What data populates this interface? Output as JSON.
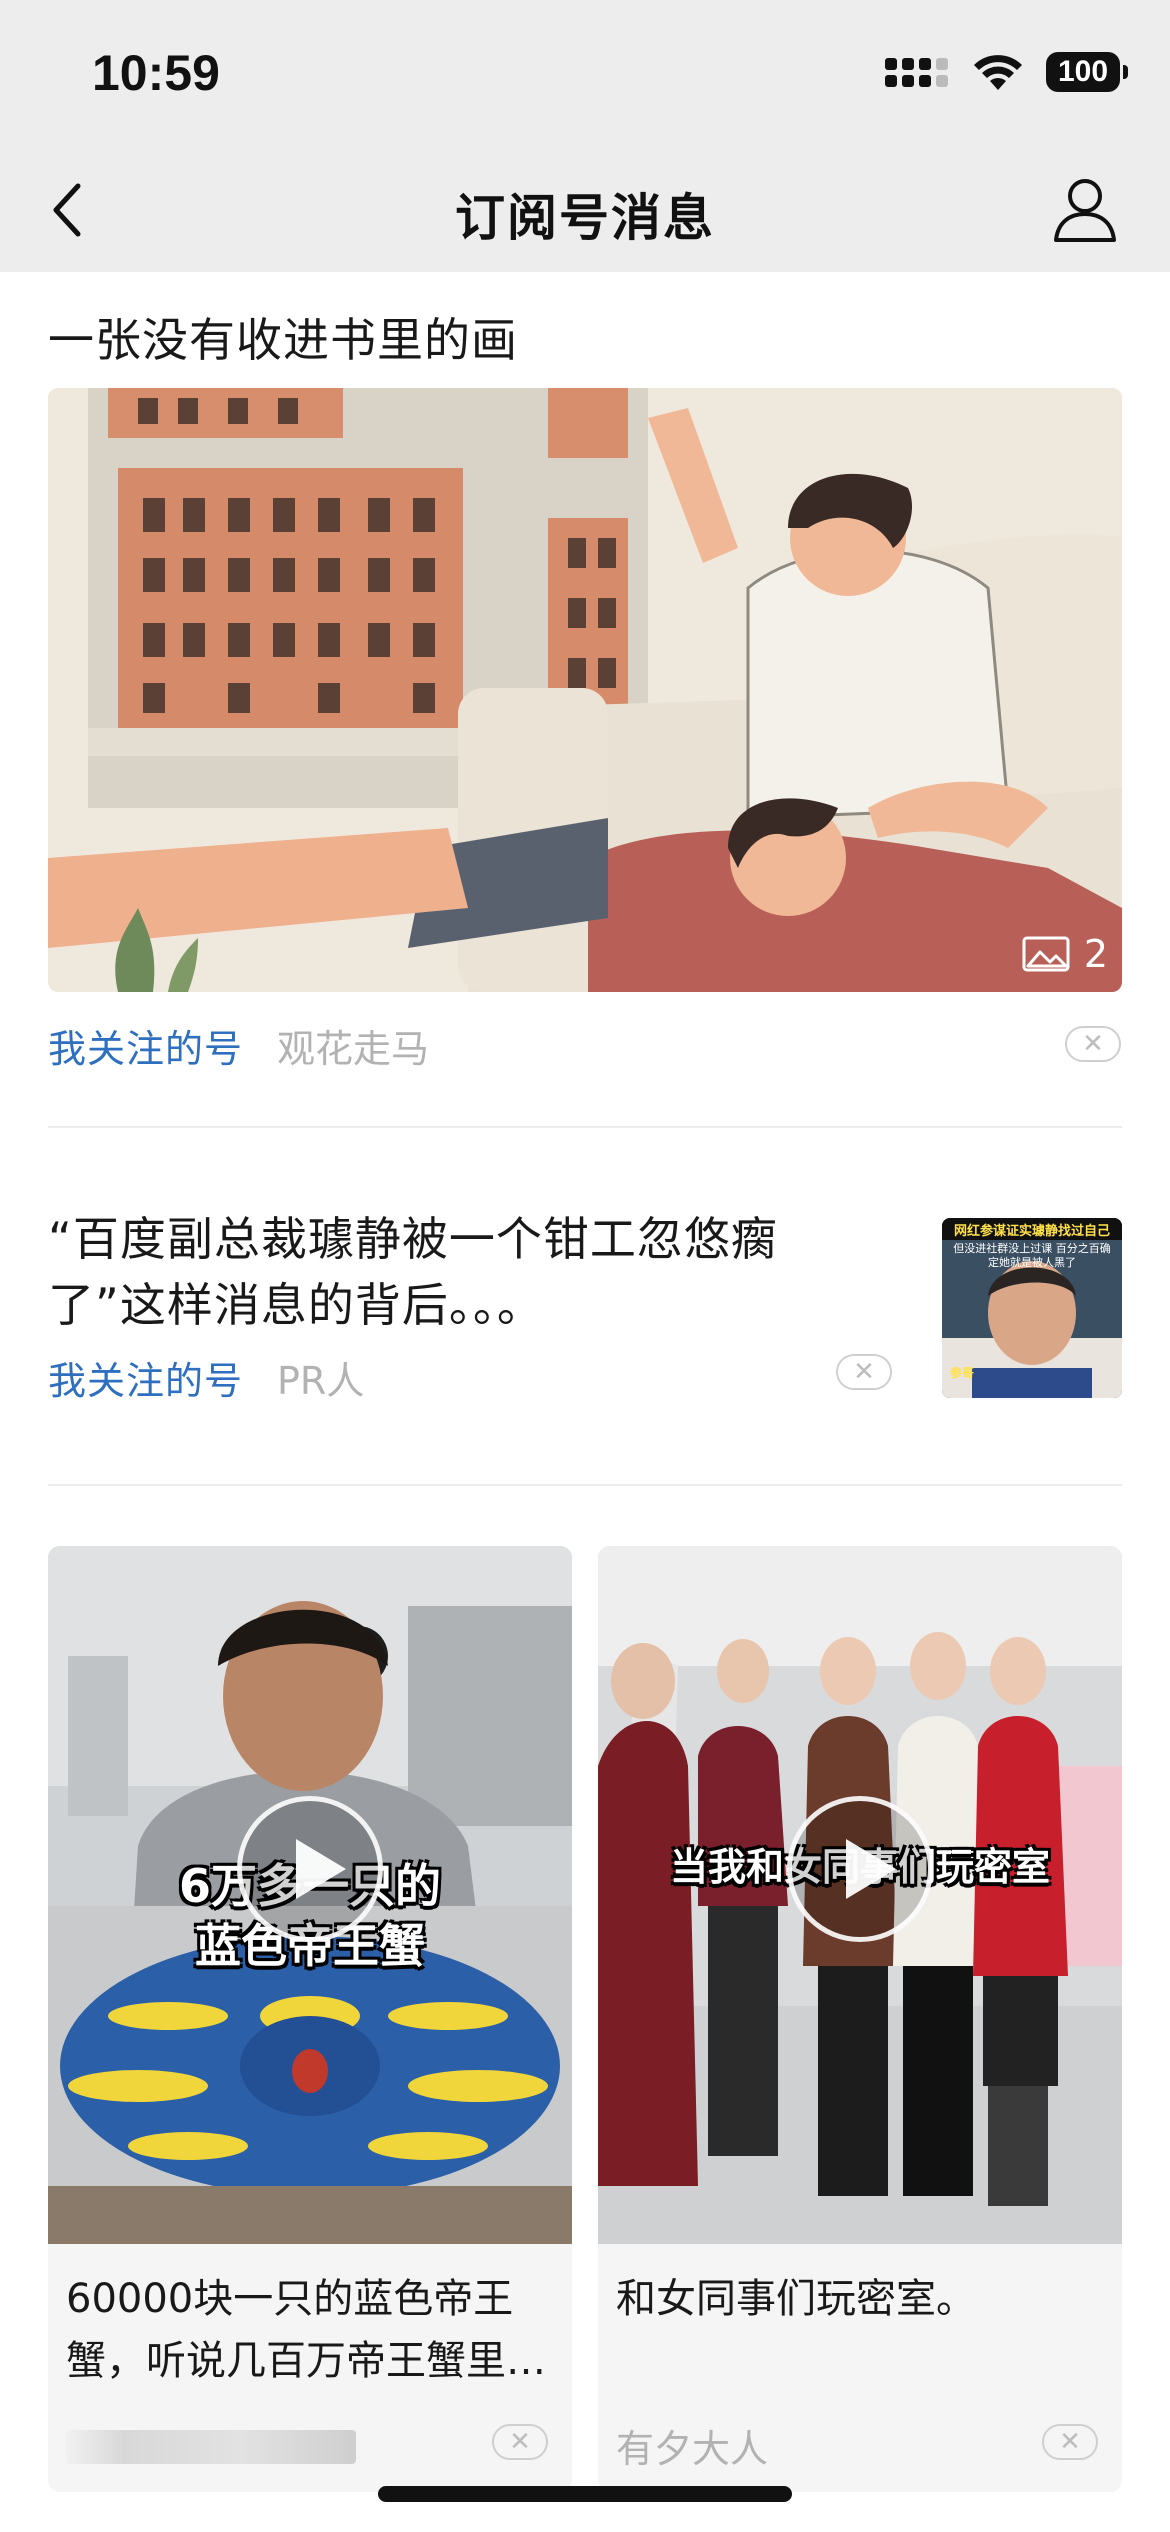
{
  "status_bar": {
    "time": "10:59",
    "battery": "100"
  },
  "nav": {
    "title": "订阅号消息"
  },
  "article1": {
    "title": "一张没有收进书里的画",
    "image_count": "2",
    "tag": "我关注的号",
    "author": "观花走马"
  },
  "article2": {
    "title": "“百度副总裁璩静被一个钳工忽悠瘸了”这样消息的背后。。。",
    "tag": "我关注的号",
    "author": "PR人",
    "thumb_caption_top": "网红参谋证实璩静找过自己",
    "thumb_caption_mid": "但没进社群没上过课 百分之百确定她就是被人黑了",
    "thumb_name": "参哥"
  },
  "video1": {
    "overlay_line1": "6万多一只的",
    "overlay_line2": "蓝色帝王蟹",
    "title": "60000块一只的蓝色帝王蟹，听说几百万帝王蟹里…"
  },
  "video2": {
    "overlay": "当我和女同事们玩密室",
    "title": "和女同事们玩密室。",
    "author": "有夕大人"
  },
  "icons": {
    "back": "chevron-left-icon",
    "profile": "person-icon",
    "image": "image-icon",
    "dismiss": "close-icon",
    "play": "play-icon"
  },
  "colors": {
    "accent": "#2f6fbf",
    "header_bg": "#ededed",
    "muted": "#b2b2b2"
  }
}
